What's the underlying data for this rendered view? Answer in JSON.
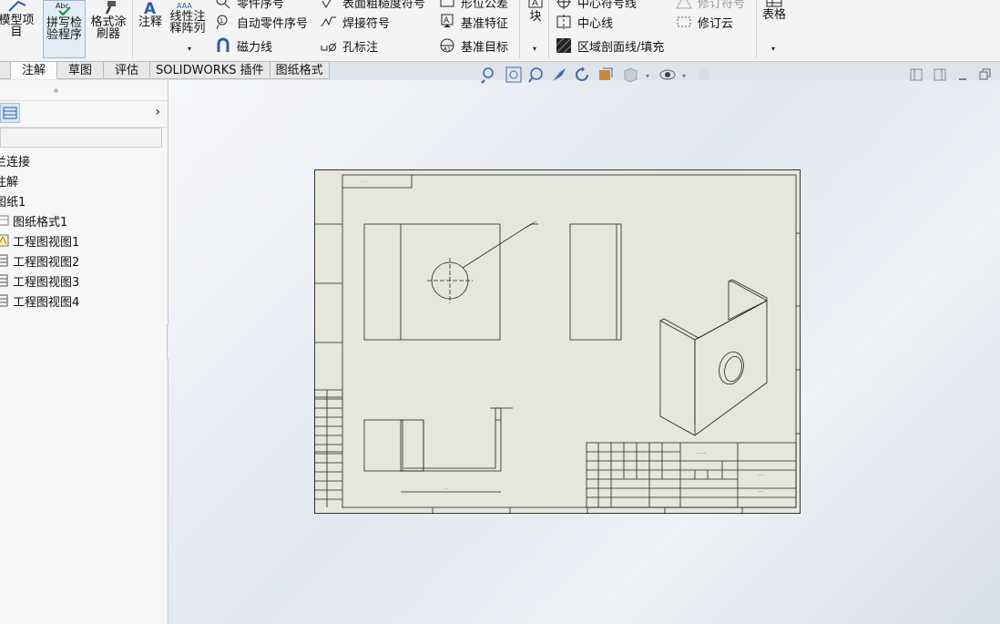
{
  "ribbon": {
    "model_items": "模型项目",
    "spell_check": "拼写检验程序",
    "format_painter": "格式涂刷器",
    "note": "注释",
    "linear_note_pattern": "线性注释阵列",
    "balloon": "零件序号",
    "auto_balloon": "自动零件序号",
    "magnetic_line": "磁力线",
    "surface_finish": "表面粗糙度符号",
    "weld_symbol": "焊接符号",
    "hole_callout": "孔标注",
    "geometric_tolerance": "形位公差",
    "datum_feature": "基准特征",
    "datum_target": "基准目标",
    "block": "块",
    "center_mark": "中心符号线",
    "centerline": "中心线",
    "area_hatch": "区域剖面线/填充",
    "revision_symbol": "修订符号",
    "revision_cloud": "修订云",
    "tables": "表格"
  },
  "tabs": [
    {
      "label": "注解",
      "active": true
    },
    {
      "label": "草图",
      "active": false
    },
    {
      "label": "评估",
      "active": false
    },
    {
      "label": "SOLIDWORKS 插件",
      "active": false
    },
    {
      "label": "图纸格式",
      "active": false
    }
  ],
  "tree": {
    "items": [
      {
        "label": "兰连接",
        "icon": "part-icon"
      },
      {
        "label": "注解",
        "icon": "annotation-folder-icon"
      },
      {
        "label": "图纸1",
        "icon": "sheet-icon"
      },
      {
        "label": "图纸格式1",
        "icon": "sheet-format-icon"
      },
      {
        "label": "工程图视图1",
        "icon": "drawing-view-icon"
      },
      {
        "label": "工程图视图2",
        "icon": "drawing-view-icon"
      },
      {
        "label": "工程图视图3",
        "icon": "drawing-view-icon"
      },
      {
        "label": "工程图视图4",
        "icon": "drawing-view-icon"
      }
    ]
  },
  "colors": {
    "sheet": "#e6e6dc",
    "ribbon": "#f4f4f4",
    "accent": "#3b73b9",
    "line": "#222222"
  }
}
